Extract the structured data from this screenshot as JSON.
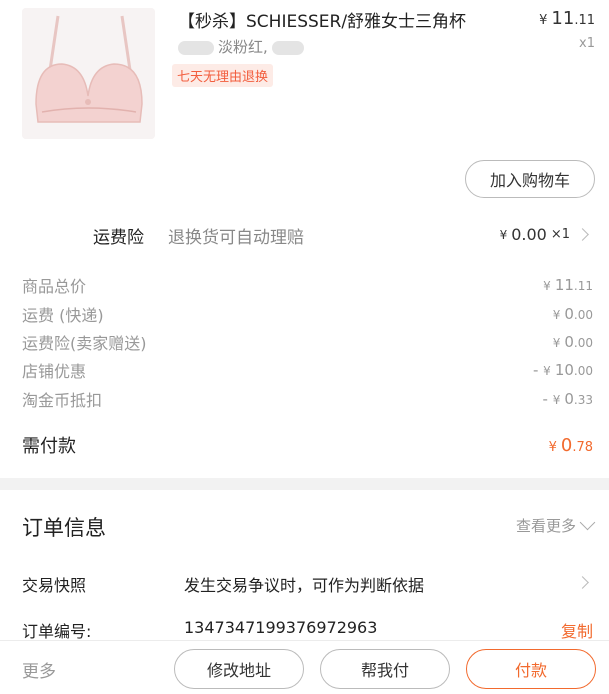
{
  "product": {
    "title": "【秒杀】SCHIESSER/舒雅女士三角杯",
    "price_currency": "¥",
    "price_int": "11",
    "price_dec": ".11",
    "quantity": "x1",
    "sku_text": "淡粉红,",
    "return_badge": "七天无理由退换",
    "add_cart_label": "加入购物车"
  },
  "insurance": {
    "label": "运费险",
    "desc": "退换货可自动理赔",
    "price_currency": "¥",
    "price": "0.00",
    "qty": "×1"
  },
  "fees": [
    {
      "label": "商品总价",
      "cur": "¥",
      "int": "11",
      "dec": ".11",
      "prefix": ""
    },
    {
      "label": "运费 (快递)",
      "cur": "¥",
      "int": "0",
      "dec": ".00",
      "prefix": ""
    },
    {
      "label": "运费险(卖家赠送)",
      "cur": "¥",
      "int": "0",
      "dec": ".00",
      "prefix": ""
    },
    {
      "label": "店铺优惠",
      "cur": "¥",
      "int": "10",
      "dec": ".00",
      "prefix": "- "
    },
    {
      "label": "淘金币抵扣",
      "cur": "¥",
      "int": "0",
      "dec": ".33",
      "prefix": "- "
    }
  ],
  "due": {
    "label": "需付款",
    "cur": "¥",
    "int": "0",
    "dec": ".78"
  },
  "order_info": {
    "title": "订单信息",
    "view_more": "查看更多",
    "snapshot_label": "交易快照",
    "snapshot_value": "发生交易争议时，可作为判断依据",
    "order_no_label": "订单编号:",
    "order_no_value": "1347347199376972963",
    "copy_label": "复制"
  },
  "bottom_bar": {
    "more": "更多",
    "modify_address": "修改地址",
    "pay_for_me": "帮我付",
    "pay": "付款"
  },
  "colors": {
    "accent": "#f26a2e",
    "badge_bg": "#fdebe6"
  }
}
